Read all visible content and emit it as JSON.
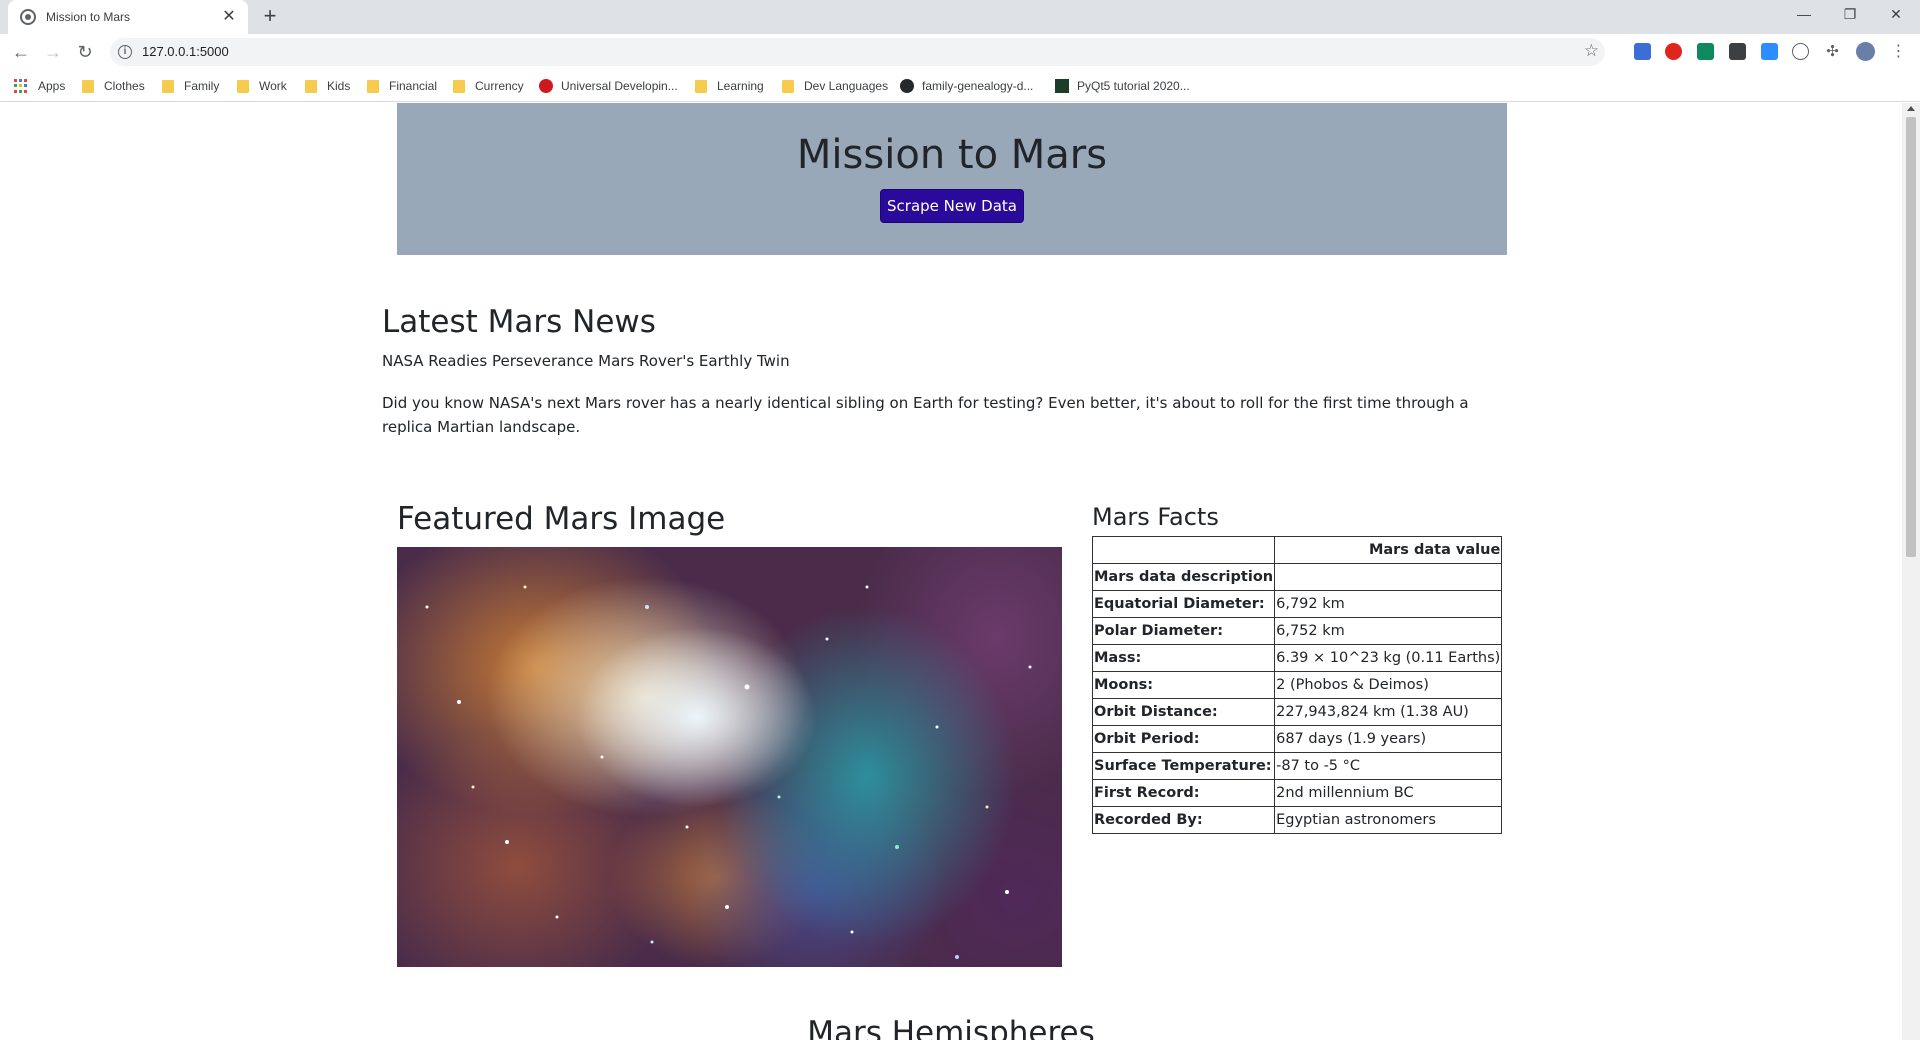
{
  "browser": {
    "tab_title": "Mission to Mars",
    "url": "127.0.0.1:5000",
    "bookmarks": [
      "Apps",
      "Clothes",
      "Family",
      "Work",
      "Kids",
      "Financial",
      "Currency",
      "Universal Developin...",
      "Learning",
      "Dev Languages",
      "family-genealogy-d...",
      "PyQt5 tutorial 2020..."
    ]
  },
  "header": {
    "title": "Mission to Mars",
    "scrape_button": "Scrape New Data"
  },
  "news": {
    "heading": "Latest Mars News",
    "title": "NASA Readies Perseverance Mars Rover's Earthly Twin",
    "paragraph": "Did you know NASA's next Mars rover has a nearly identical sibling on Earth for testing? Even better, it's about to roll for the first time through a replica Martian landscape."
  },
  "featured": {
    "heading": "Featured Mars Image"
  },
  "facts": {
    "heading": "Mars Facts",
    "column_header": "Mars data value",
    "index_header": "Mars data description",
    "rows": [
      {
        "label": "Equatorial Diameter:",
        "value": "6,792 km"
      },
      {
        "label": "Polar Diameter:",
        "value": "6,752 km"
      },
      {
        "label": "Mass:",
        "value": "6.39 × 10^23 kg (0.11 Earths)"
      },
      {
        "label": "Moons:",
        "value": "2 (Phobos & Deimos)"
      },
      {
        "label": "Orbit Distance:",
        "value": "227,943,824 km (1.38 AU)"
      },
      {
        "label": "Orbit Period:",
        "value": "687 days (1.9 years)"
      },
      {
        "label": "Surface Temperature:",
        "value": "-87 to -5 °C"
      },
      {
        "label": "First Record:",
        "value": "2nd millennium BC"
      },
      {
        "label": "Recorded By:",
        "value": "Egyptian astronomers"
      }
    ]
  },
  "hemispheres": {
    "heading": "Mars Hemispheres"
  }
}
